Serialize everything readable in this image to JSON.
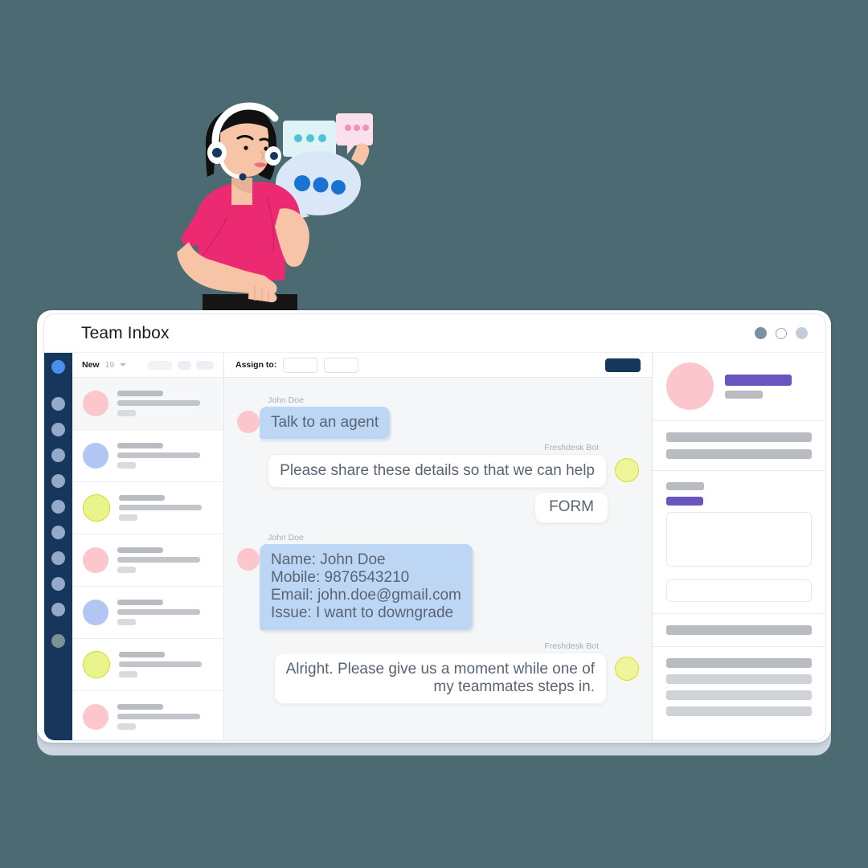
{
  "theme": {
    "page_background": "#4c6a72",
    "sidebar_navy": "#17365c",
    "accent_purple": "#6a55be",
    "user_bubble": "#bdd6f4",
    "avatar_pink": "#fbc7cd",
    "avatar_yellow": "#eef69b",
    "avatar_blue": "#b3c5f2"
  },
  "illustration": {
    "name": "support-agent-with-headset-illustration",
    "shirt_color": "#ec2a72",
    "skin_color": "#f7c4a8",
    "hair_color": "#101010",
    "skirt_color": "#161616",
    "headset_color": "#ffffff",
    "big_bubble_color": "#dae7f7",
    "big_bubble_dots": "#1a73d4",
    "small_bubble_1_color": "#dff2f6",
    "small_bubble_1_dots": "#4fc3d9",
    "small_bubble_2_color": "#fbe0ec",
    "small_bubble_2_dots": "#f48fb8"
  },
  "window": {
    "title": "Team Inbox",
    "controls": [
      {
        "name": "window-dot-filled-dark",
        "color": "#7c8fa3"
      },
      {
        "name": "window-dot-outline",
        "color": "#ffffff"
      },
      {
        "name": "window-dot-filled-light",
        "color": "#c3ccd8"
      }
    ]
  },
  "rail": {
    "items": [
      {
        "name": "rail-item-active",
        "active": true
      },
      {
        "name": "rail-item-1",
        "active": false
      },
      {
        "name": "rail-item-2",
        "active": false
      },
      {
        "name": "rail-item-3",
        "active": false
      },
      {
        "name": "rail-item-4",
        "active": false
      },
      {
        "name": "rail-item-5",
        "active": false
      },
      {
        "name": "rail-item-6",
        "active": false
      },
      {
        "name": "rail-item-7",
        "active": false
      },
      {
        "name": "rail-item-8",
        "active": false
      },
      {
        "name": "rail-item-9",
        "active": false
      }
    ],
    "bottom_item": {
      "name": "rail-item-bottom"
    }
  },
  "conversation_list": {
    "filter_label": "New",
    "count": "19",
    "items": [
      {
        "avatar": "pink",
        "selected": true
      },
      {
        "avatar": "blue",
        "selected": false
      },
      {
        "avatar": "yellow",
        "selected": false
      },
      {
        "avatar": "pink",
        "selected": false
      },
      {
        "avatar": "blue",
        "selected": false
      },
      {
        "avatar": "yellow",
        "selected": false
      },
      {
        "avatar": "pink",
        "selected": false
      }
    ]
  },
  "chat": {
    "assign_label": "Assign to:",
    "messages": [
      {
        "sender": "John Doe",
        "side": "left",
        "avatar": "pink",
        "type": "text",
        "lines": [
          "Talk to an agent"
        ]
      },
      {
        "sender": "Freshdesk Bot",
        "side": "right",
        "avatar": "yellow",
        "type": "text",
        "lines": [
          "Please share these details so that we can help"
        ]
      },
      {
        "sender": "",
        "side": "right",
        "avatar": "none",
        "type": "form",
        "lines": [
          "FORM"
        ]
      },
      {
        "sender": "John Doe",
        "side": "left",
        "avatar": "pink",
        "type": "text",
        "lines": [
          "Name: John Doe",
          "Mobile: 9876543210",
          "Email: john.doe@gmail.com",
          "Issue: I want to downgrade"
        ]
      },
      {
        "sender": "Freshdesk Bot",
        "side": "right",
        "avatar": "yellow",
        "type": "text",
        "lines": [
          "Alright. Please give us a moment while one of",
          "my teammates steps in."
        ]
      }
    ]
  },
  "details_panel": {
    "sections": [
      {
        "name": "contact-profile"
      },
      {
        "name": "contact-fields"
      },
      {
        "name": "assignment-form"
      },
      {
        "name": "tags-section"
      },
      {
        "name": "activity-section"
      }
    ]
  }
}
